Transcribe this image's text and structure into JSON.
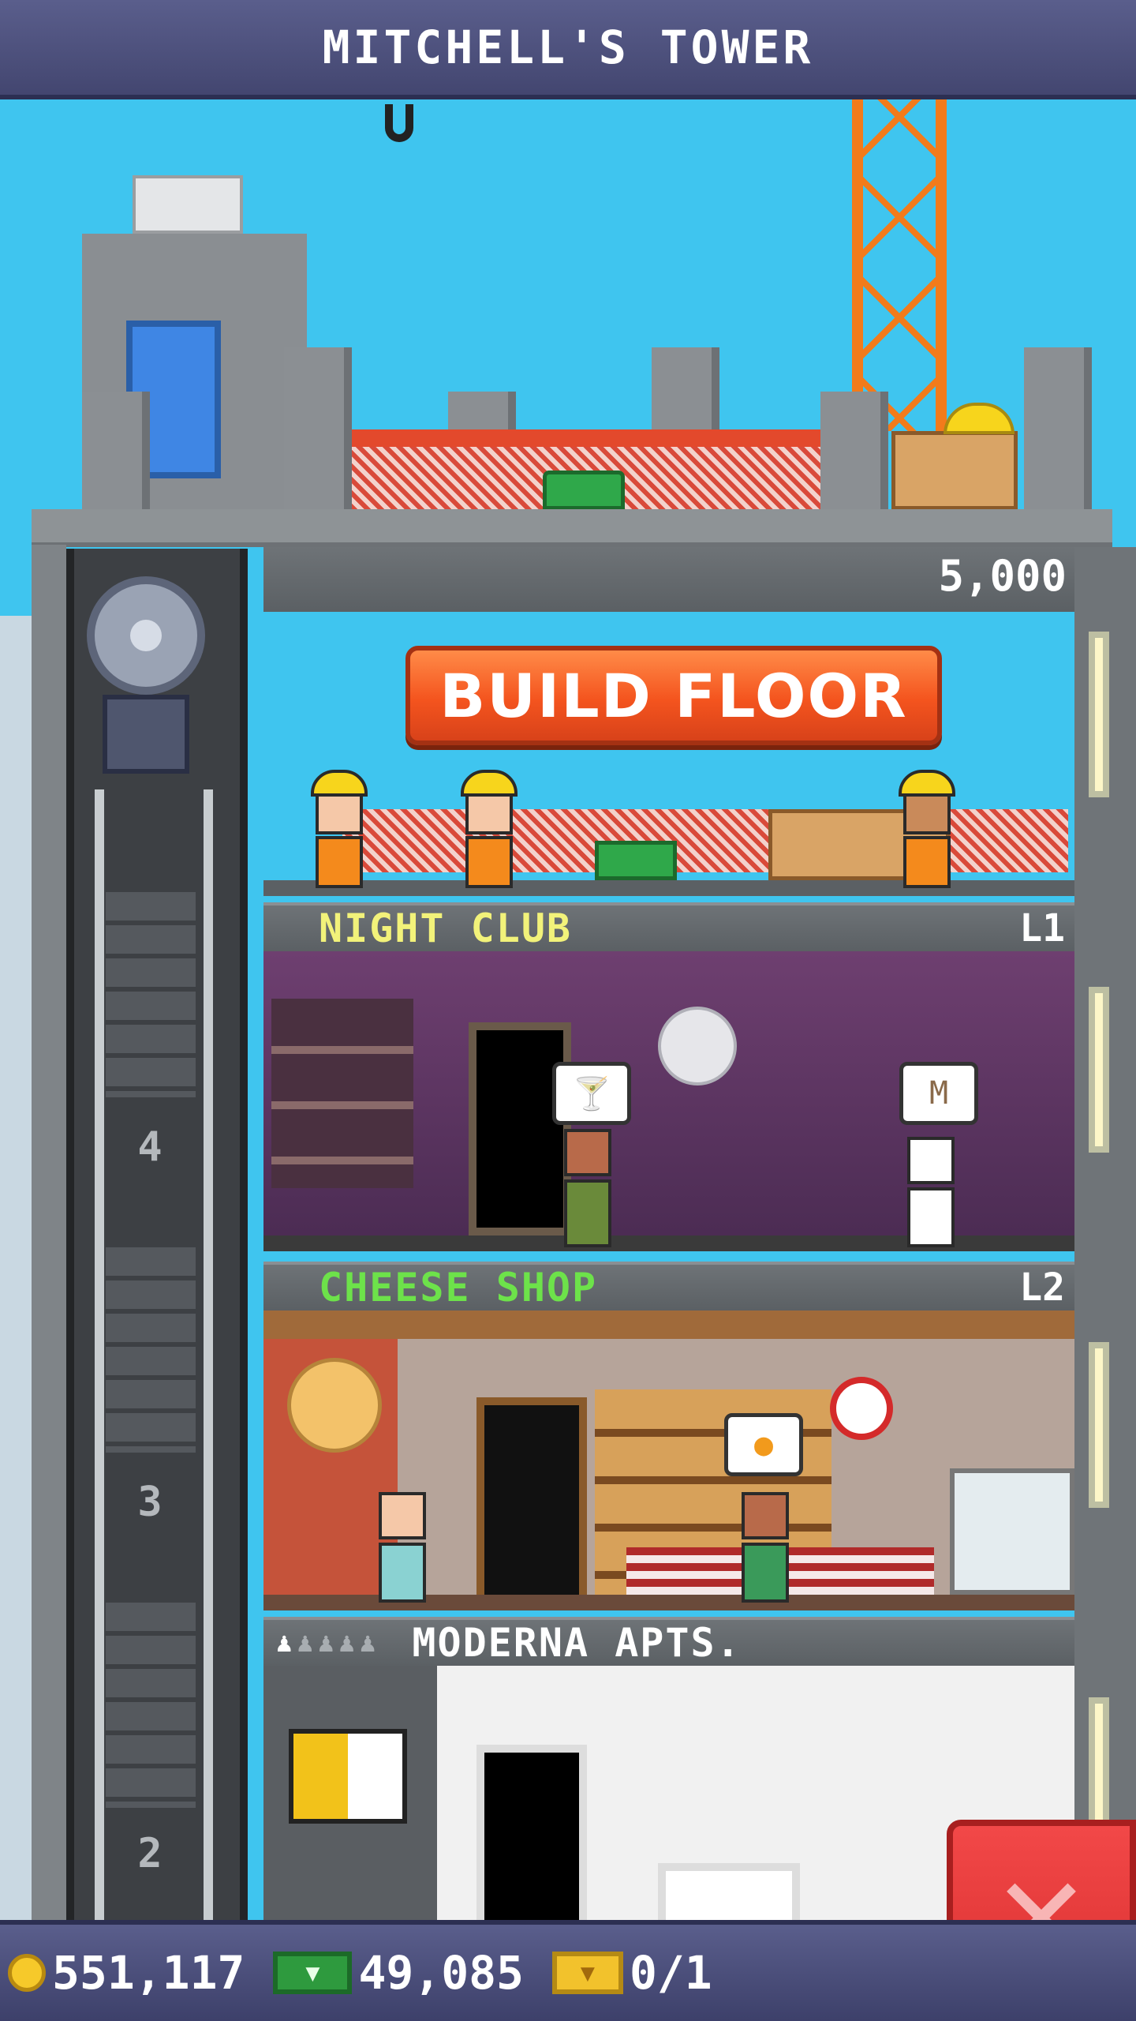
{
  "header": {
    "title": "MITCHELL'S TOWER"
  },
  "build_floor": {
    "cost": "5,000",
    "button_label": "BUILD FLOOR"
  },
  "floors": [
    {
      "name": "NIGHT CLUB",
      "level": "L1",
      "name_color": "#f2f27a"
    },
    {
      "name": "CHEESE SHOP",
      "level": "L2",
      "name_color": "#6de24a"
    },
    {
      "name": "MODERNA APTS.",
      "level": "",
      "name_color": "#ffffff",
      "residents_icon": "person-icons"
    }
  ],
  "elevator": {
    "floor_numbers": [
      "4",
      "3",
      "2"
    ]
  },
  "footer": {
    "coins": "551,117",
    "bux": "49,085",
    "vip": "0/1"
  },
  "icons": {
    "coin": "coin-icon",
    "cash": "cash-icon",
    "bux": "golden-ticket-icon",
    "close": "close-icon"
  }
}
